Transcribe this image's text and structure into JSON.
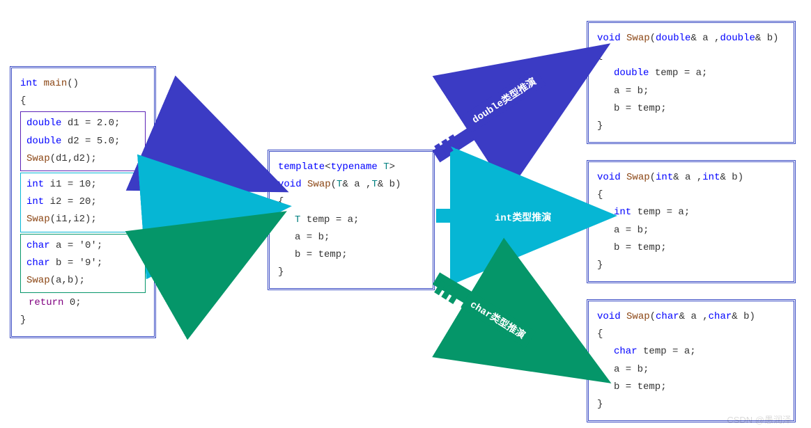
{
  "main": {
    "sig_type": "int",
    "sig_name": "main",
    "sig_paren": "()",
    "brace_open": "{",
    "brace_close": "}",
    "return_kw": "return",
    "return_val": " 0;",
    "double_block": {
      "l1_type": "double",
      "l1_rest": " d1 = 2.0;",
      "l2_type": "double",
      "l2_rest": " d2 = 5.0;",
      "l3_fn": "Swap",
      "l3_rest": "(d1,d2);"
    },
    "int_block": {
      "l1_type": "int",
      "l1_rest": " i1 = 10;",
      "l2_type": "int",
      "l2_rest": " i2 = 20;",
      "l3_fn": "Swap",
      "l3_rest": "(i1,i2);"
    },
    "char_block": {
      "l1_type": "char",
      "l1_rest": " a = '0';",
      "l2_type": "char",
      "l2_rest": " b = '9';",
      "l3_fn": "Swap",
      "l3_rest": "(a,b);"
    }
  },
  "template": {
    "l1_kw": "template",
    "l1_lt": "<",
    "l1_tn": "typename",
    "l1_t": " T",
    "l1_gt": ">",
    "l2_void": "void",
    "l2_name": " Swap",
    "l2_open": "(",
    "l2_T1": "T",
    "l2_amp1": "& a ,",
    "l2_T2": "T",
    "l2_amp2": "& b)",
    "brace_open": "{",
    "body_l1_T": "T",
    "body_l1_rest": " temp = a;",
    "body_l2": "a = b;",
    "body_l3": "b = temp;",
    "brace_close": "}"
  },
  "outputs": {
    "double": {
      "sig_void": "void",
      "sig_name": " Swap",
      "sig_open": "(",
      "p1_t": "double",
      "p1_r": "& a ,",
      "p2_t": "double",
      "p2_r": "& b)",
      "brace_open": "{",
      "body_t": "double",
      "body_rest": " temp = a;",
      "body_l2": "a = b;",
      "body_l3": "b = temp;",
      "brace_close": "}"
    },
    "int": {
      "sig_void": "void",
      "sig_name": " Swap",
      "sig_open": "(",
      "p1_t": "int",
      "p1_r": "& a ,",
      "p2_t": "int",
      "p2_r": "& b)",
      "brace_open": "{",
      "body_t": "int",
      "body_rest": " temp = a;",
      "body_l2": "a = b;",
      "body_l3": "b = temp;",
      "brace_close": "}"
    },
    "char": {
      "sig_void": "void",
      "sig_name": " Swap",
      "sig_open": "(",
      "p1_t": "char",
      "p1_r": "& a ,",
      "p2_t": "char",
      "p2_r": "& b)",
      "brace_open": "{",
      "body_t": "char",
      "body_rest": " temp = a;",
      "body_l2": "a = b;",
      "body_l3": "b = temp;",
      "brace_close": "}"
    }
  },
  "labels": {
    "double": "double类型推演",
    "int": "int类型推演",
    "char": "char类型推演"
  },
  "watermark": "CSDN @愚润泽"
}
